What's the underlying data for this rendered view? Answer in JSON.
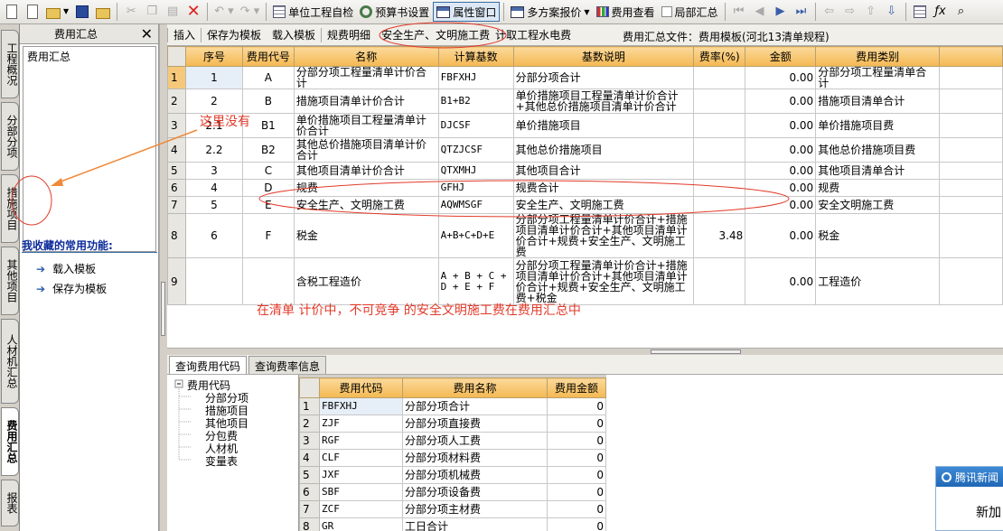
{
  "toolbar": {
    "items": [
      "单位工程自检",
      "预算书设置",
      "属性窗口",
      "多方案报价",
      "费用查看",
      "局部汇总"
    ]
  },
  "vtabs": [
    "工程概况",
    "分部分项",
    "措施项目",
    "其他项目",
    "人材机汇总",
    "费用汇总",
    "报表"
  ],
  "left_panel": {
    "title": "费用汇总",
    "tree_item": "费用汇总",
    "fav_title": "我收藏的常用功能:",
    "fav_items": [
      "载入模板",
      "保存为模板"
    ]
  },
  "subtoolbar": {
    "buttons": [
      "插入",
      "保存为模板",
      "载入模板",
      "规费明细",
      "安全生产、文明施工费",
      "计取工程水电费"
    ],
    "file_label": "费用汇总文件：费用模板(河北13清单规程)"
  },
  "main_grid": {
    "headers": [
      "序号",
      "费用代号",
      "名称",
      "计算基数",
      "基数说明",
      "费率(%)",
      "金额",
      "费用类别"
    ],
    "rows": [
      {
        "n": "1",
        "seq": "1",
        "code": "A",
        "name": "分部分项工程量清单计价合计",
        "base": "FBFXHJ",
        "desc": "分部分项合计",
        "rate": "",
        "amt": "0.00",
        "cat": "分部分项工程量清单合计"
      },
      {
        "n": "2",
        "seq": "2",
        "code": "B",
        "name": "措施项目清单计价合计",
        "base": "B1+B2",
        "desc": "单价措施项目工程量清单计价合计+其他总价措施项目清单计价合计",
        "rate": "",
        "amt": "0.00",
        "cat": "措施项目清单合计"
      },
      {
        "n": "3",
        "seq": "2.1",
        "code": "B1",
        "name": "单价措施项目工程量清单计价合计",
        "base": "DJCSF",
        "desc": "单价措施项目",
        "rate": "",
        "amt": "0.00",
        "cat": "单价措施项目费"
      },
      {
        "n": "4",
        "seq": "2.2",
        "code": "B2",
        "name": "其他总价措施项目清单计价合计",
        "base": "QTZJCSF",
        "desc": "其他总价措施项目",
        "rate": "",
        "amt": "0.00",
        "cat": "其他总价措施项目费"
      },
      {
        "n": "5",
        "seq": "3",
        "code": "C",
        "name": "其他项目清单计价合计",
        "base": "QTXMHJ",
        "desc": "其他项目合计",
        "rate": "",
        "amt": "0.00",
        "cat": "其他项目清单合计"
      },
      {
        "n": "6",
        "seq": "4",
        "code": "D",
        "name": "规费",
        "base": "GFHJ",
        "desc": "规费合计",
        "rate": "",
        "amt": "0.00",
        "cat": "规费"
      },
      {
        "n": "7",
        "seq": "5",
        "code": "E",
        "name": "安全生产、文明施工费",
        "base": "AQWMSGF",
        "desc": "安全生产、文明施工费",
        "rate": "",
        "amt": "0.00",
        "cat": "安全文明施工费"
      },
      {
        "n": "8",
        "seq": "6",
        "code": "F",
        "name": "税金",
        "base": "A+B+C+D+E",
        "desc": "分部分项工程量清单计价合计+措施项目清单计价合计+其他项目清单计价合计+规费+安全生产、文明施工费",
        "rate": "3.48",
        "amt": "0.00",
        "cat": "税金"
      },
      {
        "n": "9",
        "seq": "",
        "code": "",
        "name": "含税工程造价",
        "base": "A + B + C + D + E + F",
        "desc": "分部分项工程量清单计价合计+措施项目清单计价合计+其他项目清单计价合计+规费+安全生产、文明施工费+税金",
        "rate": "",
        "amt": "0.00",
        "cat": "工程造价"
      }
    ]
  },
  "annotations": {
    "here_missing": "这里没有",
    "note": "在清单 计价中，不可竞争 的安全文明施工费在费用汇总中"
  },
  "bottom_tabs": [
    "查询费用代码",
    "查询费率信息"
  ],
  "code_tree": {
    "root": "费用代码",
    "children": [
      "分部分项",
      "措施项目",
      "其他项目",
      "分包费",
      "人材机",
      "变量表"
    ]
  },
  "code_grid": {
    "headers": [
      "费用代码",
      "费用名称",
      "费用金额"
    ],
    "rows": [
      {
        "n": "1",
        "code": "FBFXHJ",
        "name": "分部分项合计",
        "amt": "0"
      },
      {
        "n": "2",
        "code": "ZJF",
        "name": "分部分项直接费",
        "amt": "0"
      },
      {
        "n": "3",
        "code": "RGF",
        "name": "分部分项人工费",
        "amt": "0"
      },
      {
        "n": "4",
        "code": "CLF",
        "name": "分部分项材料费",
        "amt": "0"
      },
      {
        "n": "5",
        "code": "JXF",
        "name": "分部分项机械费",
        "amt": "0"
      },
      {
        "n": "6",
        "code": "SBF",
        "name": "分部分项设备费",
        "amt": "0"
      },
      {
        "n": "7",
        "code": "ZCF",
        "name": "分部分项主材费",
        "amt": "0"
      },
      {
        "n": "8",
        "code": "GR",
        "name": "工日合计",
        "amt": "0"
      }
    ]
  },
  "popup": {
    "title": "腾讯新闻",
    "body": "新加"
  },
  "colors": {
    "annotation_red": "#e23a2a",
    "header_orange": "#f4b851",
    "selection_blue": "#3a6ea5"
  }
}
